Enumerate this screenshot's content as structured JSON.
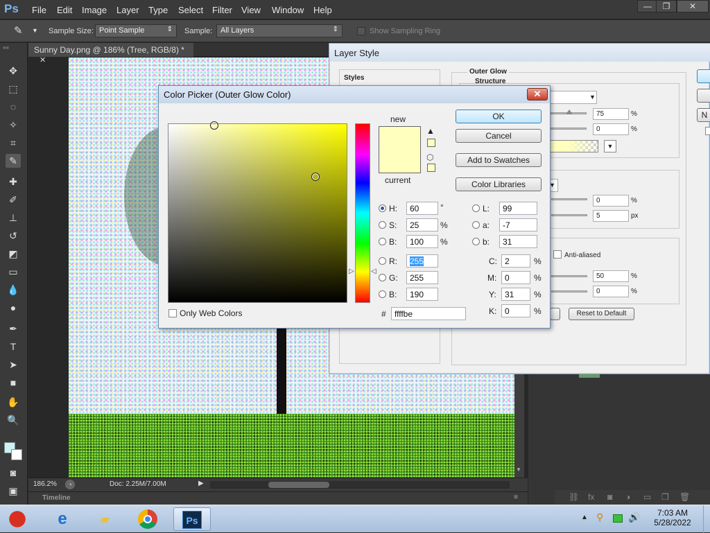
{
  "app": {
    "logo": "Ps"
  },
  "menu": [
    "File",
    "Edit",
    "Image",
    "Layer",
    "Type",
    "Select",
    "Filter",
    "View",
    "Window",
    "Help"
  ],
  "window_controls": {
    "minimize": "—",
    "restore": "❐",
    "close": "✕"
  },
  "options_bar": {
    "sample_size_label": "Sample Size:",
    "sample_size_value": "Point Sample",
    "sample_label": "Sample:",
    "sample_value": "All Layers",
    "show_ring_label": "Show Sampling Ring"
  },
  "document": {
    "tab_title": "Sunny Day.png @ 186% (Tree, RGB/8) *",
    "zoom": "186.2%",
    "doc_size": "Doc: 2.25M/7.00M",
    "timeline": "Timeline"
  },
  "layer_style": {
    "title": "Layer Style",
    "styles_label": "Styles",
    "section_title": "Outer Glow",
    "structure_label": "Structure",
    "opacity_value": "75",
    "noise_value": "0",
    "spread_value": "0",
    "size_value": "5",
    "size_unit": "px",
    "percent": "%",
    "anti_aliased_label": "Anti-aliased",
    "range_value": "50",
    "jitter_value": "0",
    "reset_label": "Reset to Default",
    "side_button_label": "N"
  },
  "color_picker": {
    "title": "Color Picker (Outer Glow Color)",
    "new_label": "new",
    "current_label": "current",
    "new_color": "#ffffbe",
    "current_color": "#ffffbe",
    "ok_label": "OK",
    "cancel_label": "Cancel",
    "add_swatches_label": "Add to Swatches",
    "color_libraries_label": "Color Libraries",
    "only_web_colors_label": "Only Web Colors",
    "hue_base": "#ffff00",
    "fields": {
      "H": {
        "label": "H:",
        "value": "60",
        "unit": "°"
      },
      "S": {
        "label": "S:",
        "value": "25",
        "unit": "%"
      },
      "Bv": {
        "label": "B:",
        "value": "100",
        "unit": "%"
      },
      "R": {
        "label": "R:",
        "value": "255"
      },
      "G": {
        "label": "G:",
        "value": "255"
      },
      "Bl": {
        "label": "B:",
        "value": "190"
      },
      "L": {
        "label": "L:",
        "value": "99"
      },
      "a": {
        "label": "a:",
        "value": "-7"
      },
      "b": {
        "label": "b:",
        "value": "31"
      },
      "C": {
        "label": "C:",
        "value": "2",
        "unit": "%"
      },
      "M": {
        "label": "M:",
        "value": "0",
        "unit": "%"
      },
      "Y": {
        "label": "Y:",
        "value": "31",
        "unit": "%"
      },
      "K": {
        "label": "K:",
        "value": "0",
        "unit": "%"
      }
    },
    "hex_label": "#",
    "hex_value": "ffffbe"
  },
  "taskbar": {
    "time": "7:03 AM",
    "date": "5/28/2022",
    "ps_label": "Ps"
  }
}
